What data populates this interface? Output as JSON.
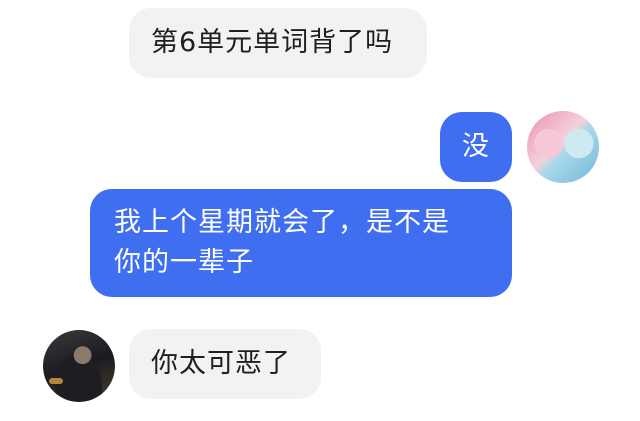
{
  "messages": [
    {
      "side": "left",
      "text": "第6单元单词背了吗"
    },
    {
      "side": "right",
      "text": "没"
    },
    {
      "side": "right",
      "line1": "我上个星期就会了，是不是",
      "line2": "你的一辈子"
    },
    {
      "side": "left",
      "text": "你太可恶了"
    }
  ],
  "colors": {
    "outgoing_bubble": "#3f6ff0",
    "incoming_bubble": "#f2f2f4"
  }
}
